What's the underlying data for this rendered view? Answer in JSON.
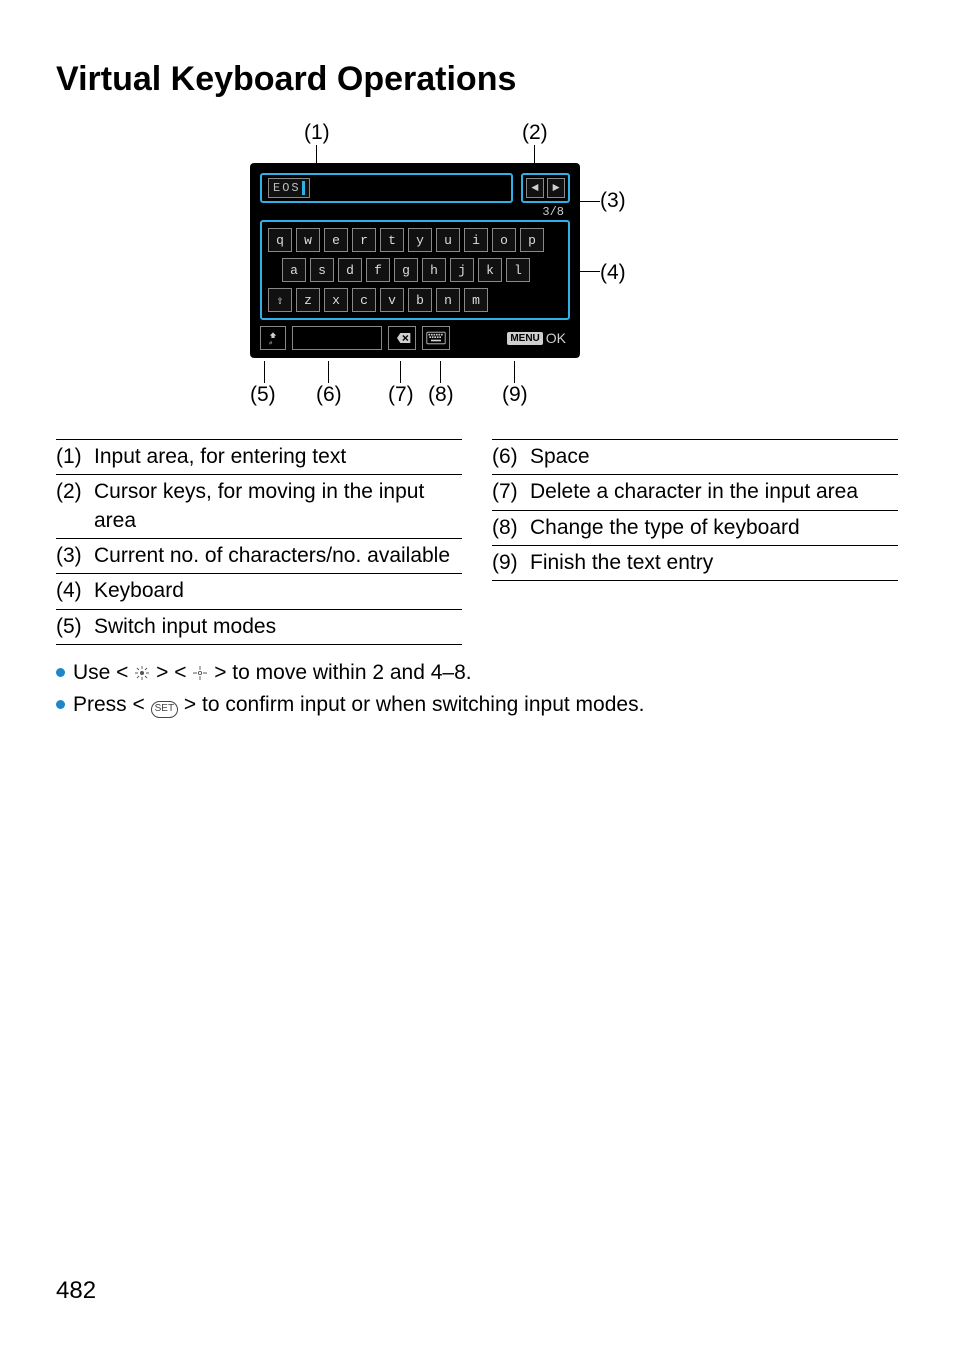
{
  "title": "Virtual Keyboard Operations",
  "page_number": "482",
  "device": {
    "input_value": "EOS",
    "char_count": "3/8",
    "rows": [
      [
        "q",
        "w",
        "e",
        "r",
        "t",
        "y",
        "u",
        "i",
        "o",
        "p"
      ],
      [
        "a",
        "s",
        "d",
        "f",
        "g",
        "h",
        "j",
        "k",
        "l"
      ],
      [
        "⇧",
        "z",
        "x",
        "c",
        "v",
        "b",
        "n",
        "m"
      ]
    ],
    "menu_label": "MENU",
    "ok_label": "OK"
  },
  "callouts": {
    "c1": "(1)",
    "c2": "(2)",
    "c3": "(3)",
    "c4": "(4)",
    "c5": "(5)",
    "c6": "(6)",
    "c7": "(7)",
    "c8": "(8)",
    "c9": "(9)"
  },
  "legend_left": [
    {
      "n": "(1)",
      "t": "Input area, for entering text"
    },
    {
      "n": "(2)",
      "t": "Cursor keys, for moving in the input area"
    },
    {
      "n": "(3)",
      "t": "Current no. of characters/no. available"
    },
    {
      "n": "(4)",
      "t": "Keyboard"
    },
    {
      "n": "(5)",
      "t": "Switch input modes"
    }
  ],
  "legend_right": [
    {
      "n": "(6)",
      "t": "Space"
    },
    {
      "n": "(7)",
      "t": "Delete a character in the input area"
    },
    {
      "n": "(8)",
      "t": "Change the type of keyboard"
    },
    {
      "n": "(9)",
      "t": "Finish the text entry"
    }
  ],
  "notes": {
    "line1_pre": "Use <",
    "line1_mid1": "> <",
    "line1_post": "> to move within 2 and 4–8.",
    "line2_pre": "Press <",
    "line2_post": "> to confirm input or when switching input modes.",
    "set_label": "SET"
  }
}
